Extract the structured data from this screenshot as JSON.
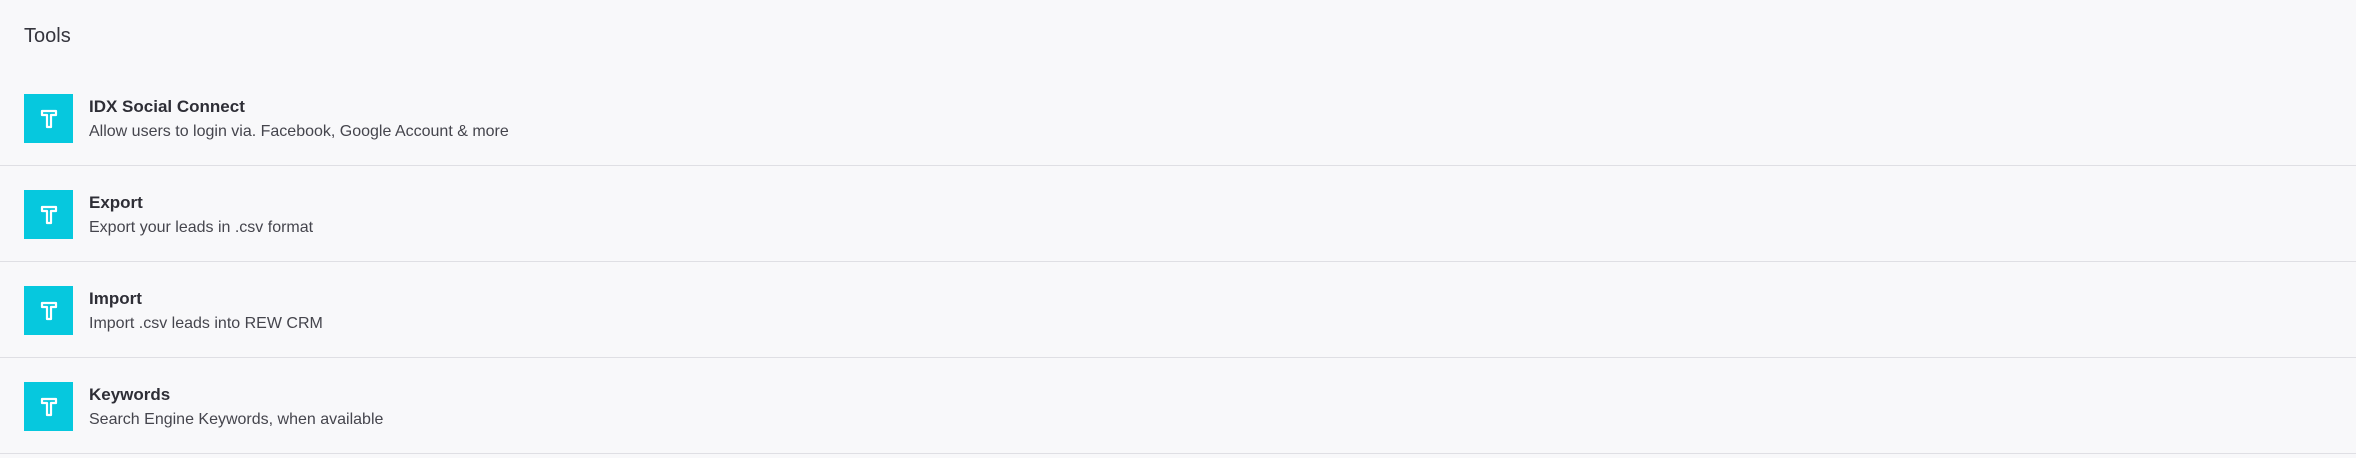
{
  "section": {
    "title": "Tools"
  },
  "icon": {
    "name": "tool-icon",
    "color": "#06c8de"
  },
  "tools": [
    {
      "title": "IDX Social Connect",
      "description": "Allow users to login via. Facebook, Google Account & more"
    },
    {
      "title": "Export",
      "description": "Export your leads in .csv format"
    },
    {
      "title": "Import",
      "description": "Import .csv leads into REW CRM"
    },
    {
      "title": "Keywords",
      "description": "Search Engine Keywords, when available"
    }
  ]
}
